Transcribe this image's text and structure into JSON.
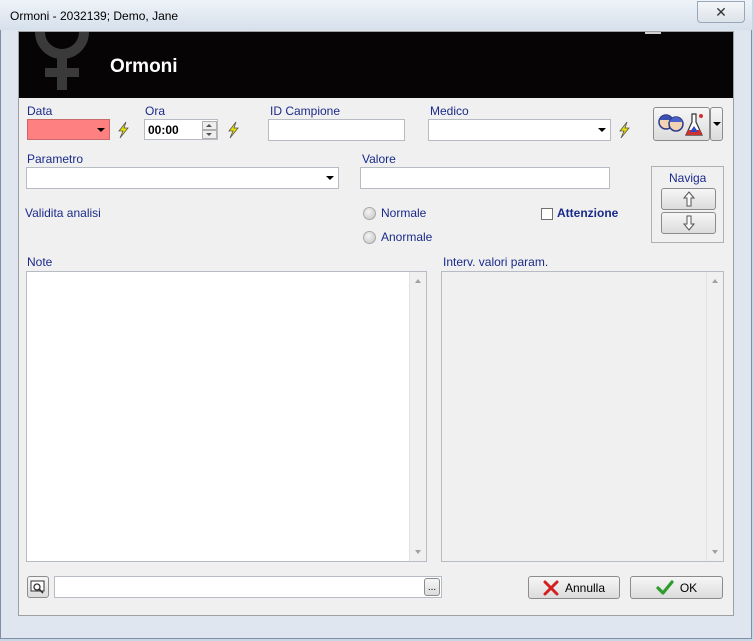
{
  "window": {
    "title": "Ormoni - 2032139; Demo, Jane",
    "close_label": "✕"
  },
  "header": {
    "title": "Ormoni"
  },
  "fields": {
    "data_label": "Data",
    "ora_label": "Ora",
    "ora_value": "00:00",
    "id_campione_label": "ID Campione",
    "medico_label": "Medico",
    "parametro_label": "Parametro",
    "valore_label": "Valore",
    "validita_label": "Validita analisi",
    "normale_label": "Normale",
    "anormale_label": "Anormale",
    "attenzione_label": "Attenzione",
    "note_label": "Note",
    "interv_label": "Interv. valori param."
  },
  "naviga": {
    "label": "Naviga"
  },
  "buttons": {
    "annulla": "Annulla",
    "ok": "OK",
    "browse": "..."
  },
  "colors": {
    "date_field": "#ff8080",
    "header_bg": "#060404",
    "label": "#1a2a8a",
    "cancel_x": "#d21f1f",
    "ok_check": "#2e9d2e"
  }
}
